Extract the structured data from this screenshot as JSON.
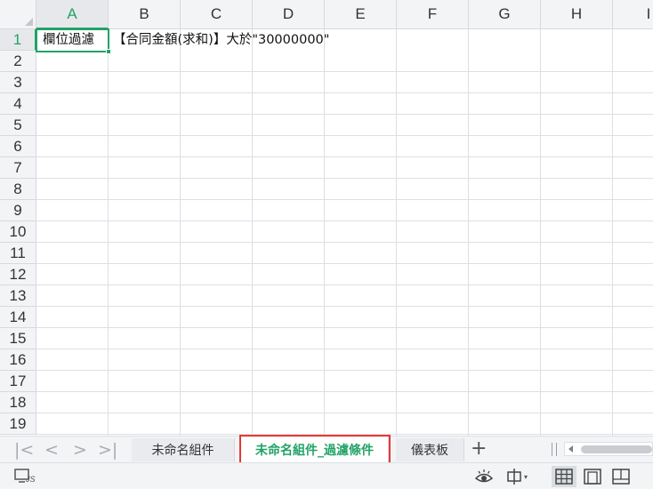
{
  "grid": {
    "columns": [
      "A",
      "B",
      "C",
      "D",
      "E",
      "F",
      "G",
      "H",
      "I"
    ],
    "active_column": "A",
    "rows": [
      "1",
      "2",
      "3",
      "4",
      "5",
      "6",
      "7",
      "8",
      "9",
      "10",
      "11",
      "12",
      "13",
      "14",
      "15",
      "16",
      "17",
      "18",
      "19"
    ],
    "active_row": "1",
    "cells": {
      "a1": "欄位過濾",
      "b1": "【合同金額(求和)】大於\"30000000\""
    },
    "accent_color": "#21a366"
  },
  "sheet_tabs": {
    "tabs": [
      {
        "label": "未命名組件",
        "active": false
      },
      {
        "label": "未命名組件_過濾條件",
        "active": true
      },
      {
        "label": "儀表板",
        "active": false
      }
    ],
    "highlight_color": "#e53935"
  },
  "status_bar": {
    "js_label": "JS"
  }
}
